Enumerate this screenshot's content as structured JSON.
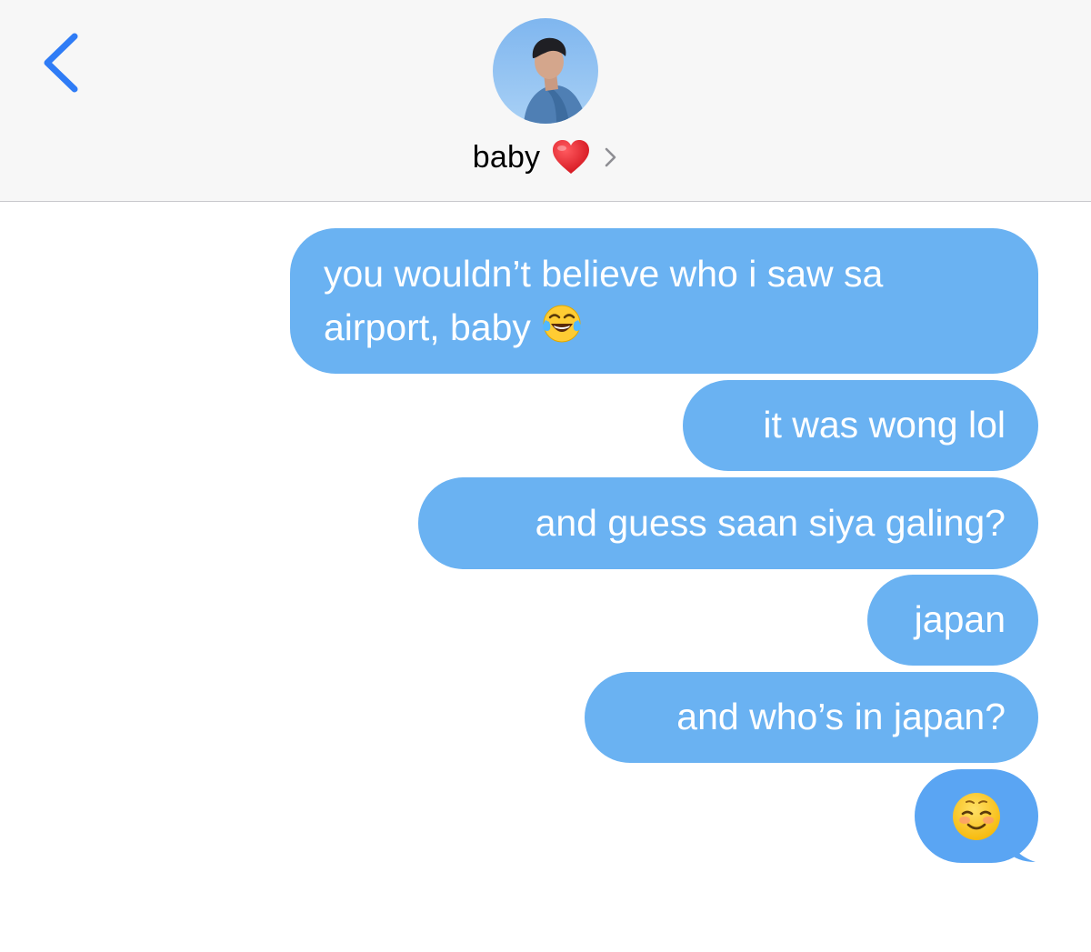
{
  "header": {
    "contact_name": "baby",
    "contact_emoji": "red-heart-icon",
    "avatar": "contact-avatar"
  },
  "colors": {
    "header_bg": "#f7f7f7",
    "bubble_blue": "#6ab2f2",
    "bubble_last": "#5aa5f3",
    "back_chevron": "#2f7cf6",
    "text_white": "#ffffff"
  },
  "messages": [
    {
      "text_line1": "you wouldn’t believe who i saw sa",
      "text_line2": "airport, baby",
      "emoji": "face-with-tears-of-joy-icon"
    },
    {
      "text": "it was wong lol"
    },
    {
      "text": "and guess saan siya galing?"
    },
    {
      "text": "japan"
    },
    {
      "text": "and who’s in japan?"
    },
    {
      "text": "",
      "emoji": "smiling-face-icon"
    }
  ]
}
